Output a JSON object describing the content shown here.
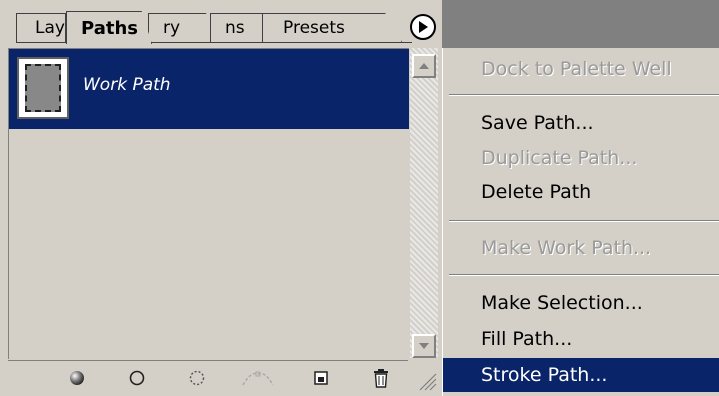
{
  "palette": {
    "tabs": [
      {
        "label": "Lay"
      },
      {
        "label": "Paths"
      },
      {
        "label": "ry"
      },
      {
        "label": "ns"
      },
      {
        "label": "Presets"
      }
    ],
    "paths": [
      {
        "name": "Work Path",
        "selected": true
      }
    ],
    "bottom_icons": [
      "fill-path-icon",
      "stroke-path-icon",
      "load-selection-icon",
      "make-work-path-icon",
      "new-path-icon",
      "trash-icon"
    ]
  },
  "menu": {
    "items": [
      {
        "label": "Dock to Palette Well",
        "enabled": false
      },
      {
        "label": "Save Path...",
        "enabled": true
      },
      {
        "label": "Duplicate Path...",
        "enabled": false
      },
      {
        "label": "Delete Path",
        "enabled": true
      },
      {
        "label": "Make Work Path...",
        "enabled": false
      },
      {
        "label": "Make Selection...",
        "enabled": true
      },
      {
        "label": "Fill Path...",
        "enabled": true
      },
      {
        "label": "Stroke Path...",
        "enabled": true,
        "selected": true
      }
    ]
  },
  "colors": {
    "selection": "#0a246a",
    "face": "#d4d0c8"
  }
}
